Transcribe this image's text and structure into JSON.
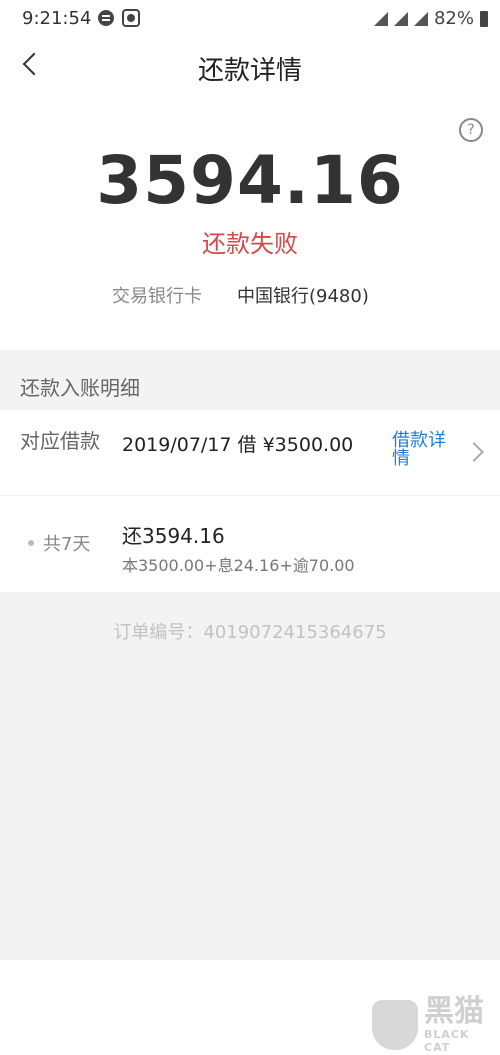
{
  "status_bar": {
    "time": "9:21:54",
    "battery": "82%"
  },
  "header": {
    "title": "还款详情"
  },
  "summary": {
    "amount": "3594.16",
    "status": "还款失败",
    "bank_label": "交易银行卡",
    "bank_value": "中国银行(9480)"
  },
  "section": {
    "title": "还款入账明细"
  },
  "loan_row": {
    "label": "对应借款",
    "value": "2019/07/17 借 ¥3500.00",
    "link": "借款详情"
  },
  "plan_row": {
    "days": "共7天",
    "main": "还3594.16",
    "sub": "本3500.00+息24.16+逾70.00"
  },
  "order": {
    "text": "订单编号：4019072415364675"
  },
  "watermark": {
    "cn": "黑猫",
    "en": "BLACK CAT"
  },
  "colors": {
    "failure": "#d44a4a",
    "link": "#1e7fd6"
  }
}
